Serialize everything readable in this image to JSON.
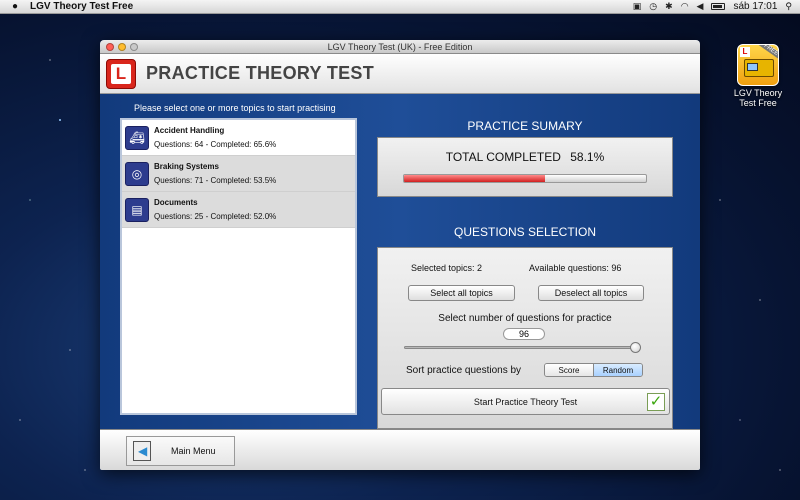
{
  "menubar": {
    "app_name": "LGV Theory Test Free",
    "clock": "sáb 17:01"
  },
  "desktop_icon": {
    "label": "LGV Theory Test Free"
  },
  "window": {
    "title": "LGV Theory Test (UK) - Free Edition",
    "header_title": "PRACTICE THEORY TEST",
    "logo_letter": "L"
  },
  "topics": {
    "caption": "Please select one or more topics to start practising",
    "items": [
      {
        "name": "Accident Handling",
        "stats": "Questions: 64 - Completed: 65.6%",
        "selected": false,
        "icon": "ambulance-icon"
      },
      {
        "name": "Braking Systems",
        "stats": "Questions: 71 - Completed: 53.5%",
        "selected": true,
        "icon": "brake-icon"
      },
      {
        "name": "Documents",
        "stats": "Questions: 25 - Completed: 52.0%",
        "selected": true,
        "icon": "document-icon"
      }
    ]
  },
  "summary": {
    "title": "PRACTICE SUMARY",
    "total_label": "TOTAL COMPLETED",
    "total_value": "58.1%",
    "progress_fraction": 0.581,
    "progress_color": "#d12020"
  },
  "selection": {
    "title": "QUESTIONS SELECTION",
    "selected_topics_label": "Selected topics:  2",
    "available_questions_label": "Available questions:  96",
    "select_all": "Select all topics",
    "deselect_all": "Deselect all topics",
    "number_label": "Select number of questions for practice",
    "number_value": "96",
    "slider_fraction": 1.0,
    "sort_label": "Sort practice questions by",
    "sort_options": [
      "Score",
      "Random"
    ],
    "sort_active": "Random"
  },
  "start_button": "Start Practice Theory Test",
  "footer": {
    "main_menu": "Main Menu"
  }
}
